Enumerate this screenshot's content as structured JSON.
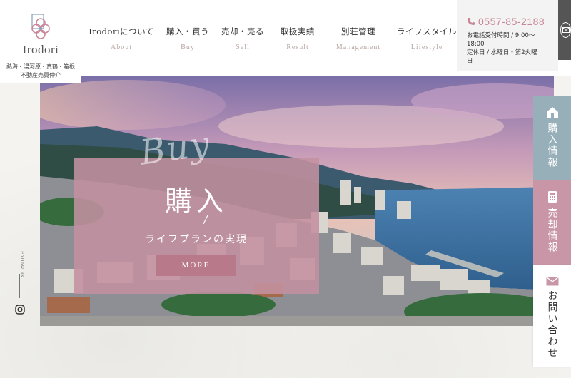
{
  "brand": {
    "name": "Irodori",
    "tagline_line1": "熱海・湯河原・真鶴・箱根",
    "tagline_line2": "不動産売買仲介"
  },
  "nav": [
    {
      "jp": "Irodoriについて",
      "en": "About"
    },
    {
      "jp": "購入・買う",
      "en": "Buy"
    },
    {
      "jp": "売却・売る",
      "en": "Sell"
    },
    {
      "jp": "取扱実績",
      "en": "Result"
    },
    {
      "jp": "別荘管理",
      "en": "Management"
    },
    {
      "jp": "ライフスタイル",
      "en": "Lifestyle"
    }
  ],
  "contact": {
    "phone": "0557-85-2188",
    "hours_line1": "お電話受付時間 / 9:00〜",
    "hours_line2": "18:00",
    "hours_line3": "定休日 / 水曜日・第2火曜",
    "hours_line4": "日"
  },
  "hero": {
    "script_word": "Buy",
    "title": "購入",
    "subtitle": "ライフプランの実現",
    "more_label": "MORE"
  },
  "social": {
    "follow_label": "Follow us"
  },
  "side_tabs": {
    "buy": "購入情報",
    "sell": "売却情報",
    "contact": "お問い合わせ"
  },
  "colors": {
    "accent_pink": "#c896a6",
    "accent_blue": "#97afb9",
    "phone": "#c9889a"
  }
}
